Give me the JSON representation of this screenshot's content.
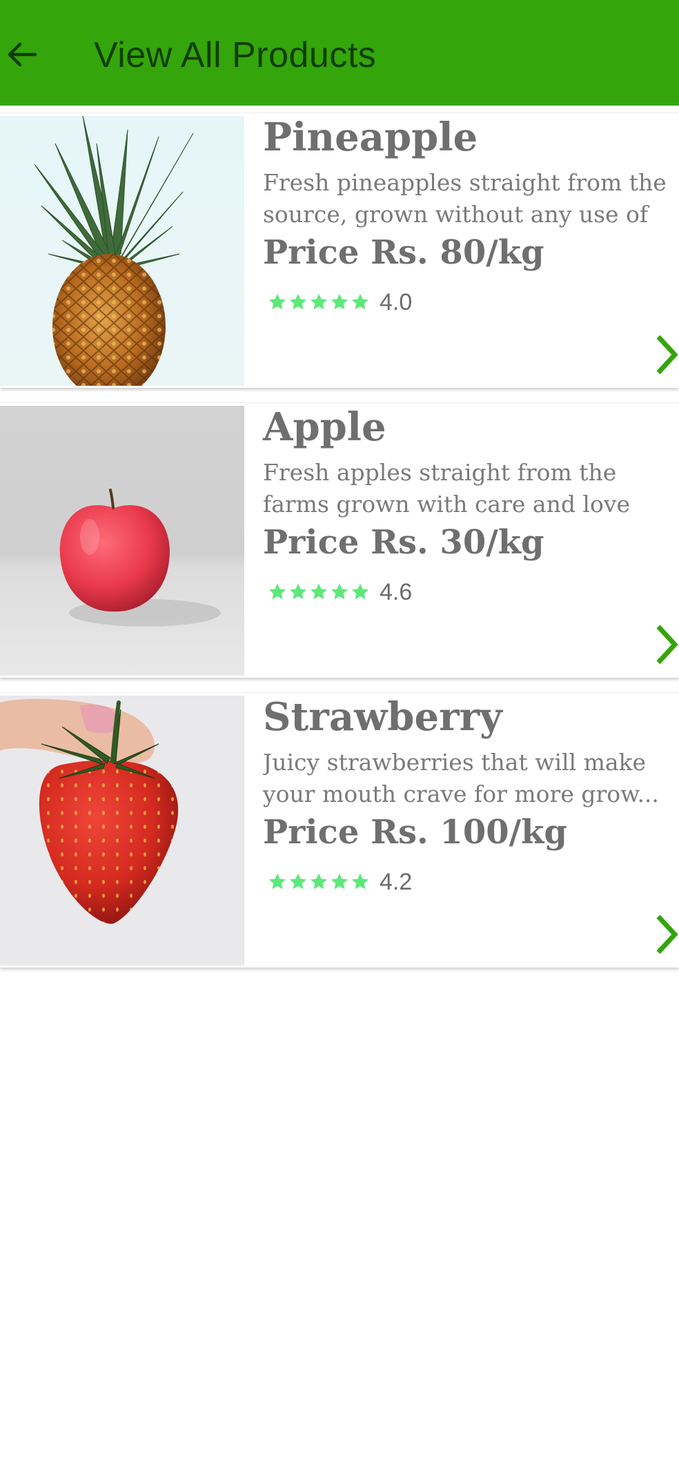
{
  "appbar": {
    "title": "View All Products",
    "back_icon": "arrow-left-icon",
    "color": "#34a50b"
  },
  "products": [
    {
      "name": "Pineapple",
      "desc_line1": "Fresh pineapples straight from the",
      "desc_line2": "source, grown without any use of",
      "price": "Price Rs. 80/kg",
      "rating": "4.0",
      "image": "pineapple-image"
    },
    {
      "name": "Apple",
      "desc_line1": "Fresh apples straight from the",
      "desc_line2": "farms grown with care and love",
      "price": "Price Rs. 30/kg",
      "rating": "4.6",
      "image": "apple-image"
    },
    {
      "name": "Strawberry",
      "desc_line1": "Juicy strawberries that will make",
      "desc_line2": "your mouth crave for more grow...",
      "price": "Price Rs. 100/kg",
      "rating": "4.2",
      "image": "strawberry-image"
    }
  ],
  "colors": {
    "star": "#5ee87a",
    "chevron": "#34a50b",
    "text": "#6f6f6f"
  }
}
